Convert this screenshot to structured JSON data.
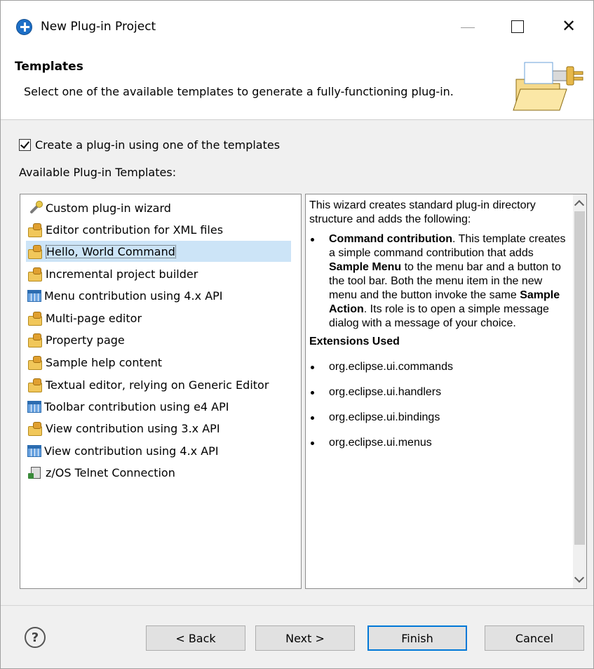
{
  "window": {
    "title": "New Plug-in Project"
  },
  "header": {
    "title": "Templates",
    "description": "Select one of the available templates to generate a fully-functioning plug-in."
  },
  "create_checkbox": {
    "label": "Create a plug-in using one of the templates",
    "checked": true
  },
  "available_label": "Available Plug-in Templates:",
  "templates": [
    {
      "label": "Custom plug-in wizard",
      "icon": "wizard-wand-icon"
    },
    {
      "label": "Editor contribution for XML files",
      "icon": "plugin-icon"
    },
    {
      "label": "Hello, World Command",
      "icon": "plugin-icon",
      "selected": true
    },
    {
      "label": "Incremental project builder",
      "icon": "plugin-icon"
    },
    {
      "label": "Menu contribution using 4.x API",
      "icon": "e4-template-icon"
    },
    {
      "label": "Multi-page editor",
      "icon": "plugin-icon"
    },
    {
      "label": "Property page",
      "icon": "plugin-icon"
    },
    {
      "label": "Sample help content",
      "icon": "plugin-icon"
    },
    {
      "label": "Textual editor, relying on Generic Editor",
      "icon": "plugin-icon"
    },
    {
      "label": "Toolbar contribution using e4 API",
      "icon": "e4-template-icon"
    },
    {
      "label": "View contribution using 3.x API",
      "icon": "plugin-icon"
    },
    {
      "label": "View contribution using 4.x API",
      "icon": "e4-template-icon"
    },
    {
      "label": "z/OS Telnet Connection",
      "icon": "telnet-icon"
    }
  ],
  "description": {
    "intro": "This wizard creates standard plug-in directory structure and adds the following:",
    "bullet_bold": "Command contribution",
    "bullet_text_1": ". This template creates a simple command contribution that adds ",
    "bullet_bold_2": "Sample Menu",
    "bullet_text_2": " to the menu bar and a button to the tool bar. Both the menu item in the new menu and the button invoke the same ",
    "bullet_bold_3": "Sample Action",
    "bullet_text_3": ". Its role is to open a simple message dialog with a message of your choice.",
    "extensions_heading": "Extensions Used",
    "extensions": [
      "org.eclipse.ui.commands",
      "org.eclipse.ui.handlers",
      "org.eclipse.ui.bindings",
      "org.eclipse.ui.menus"
    ]
  },
  "buttons": {
    "back": "< Back",
    "next": "Next >",
    "finish": "Finish",
    "cancel": "Cancel",
    "help": "?"
  },
  "colors": {
    "selection": "#cce4f7",
    "default_button_border": "#0078d7"
  }
}
